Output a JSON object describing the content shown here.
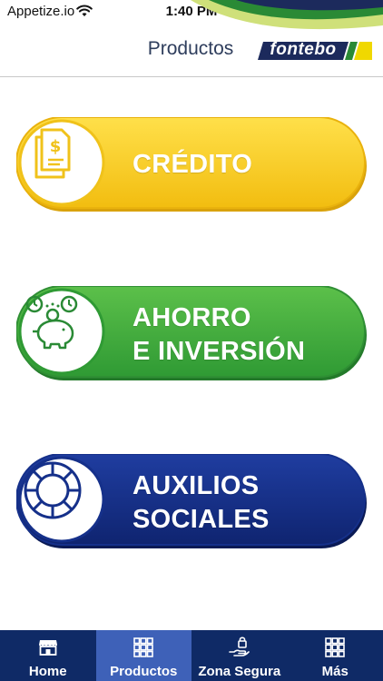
{
  "status_bar": {
    "carrier": "Appetize.io",
    "time": "1:40 PM"
  },
  "header": {
    "title": "Productos",
    "logo_text": "fontebo"
  },
  "products": [
    {
      "label_line1": "CRÉDITO",
      "label_line2": "",
      "icon": "document-dollar-icon",
      "color": "#f6c81c"
    },
    {
      "label_line1": "AHORRO",
      "label_line2": "E INVERSIÓN",
      "icon": "piggy-bank-clock-icon",
      "color": "#45ad3c"
    },
    {
      "label_line1": "AUXILIOS",
      "label_line2": "SOCIALES",
      "icon": "life-ring-icon",
      "color": "#152e86"
    }
  ],
  "tab_bar": {
    "active_tab": "Productos",
    "tabs": [
      {
        "label": "Home",
        "icon": "store-icon"
      },
      {
        "label": "Productos",
        "icon": "grid-icon"
      },
      {
        "label": "Zona Segura",
        "icon": "lock-hand-icon"
      },
      {
        "label": "Más",
        "icon": "grid-icon"
      }
    ]
  },
  "colors": {
    "header_navy": "#1c2a5c",
    "brand_yellow": "#f0d800",
    "brand_green": "#2a8a35",
    "tab_bar_bg": "#0f2a66",
    "tab_active_bg": "#3e61b8"
  }
}
